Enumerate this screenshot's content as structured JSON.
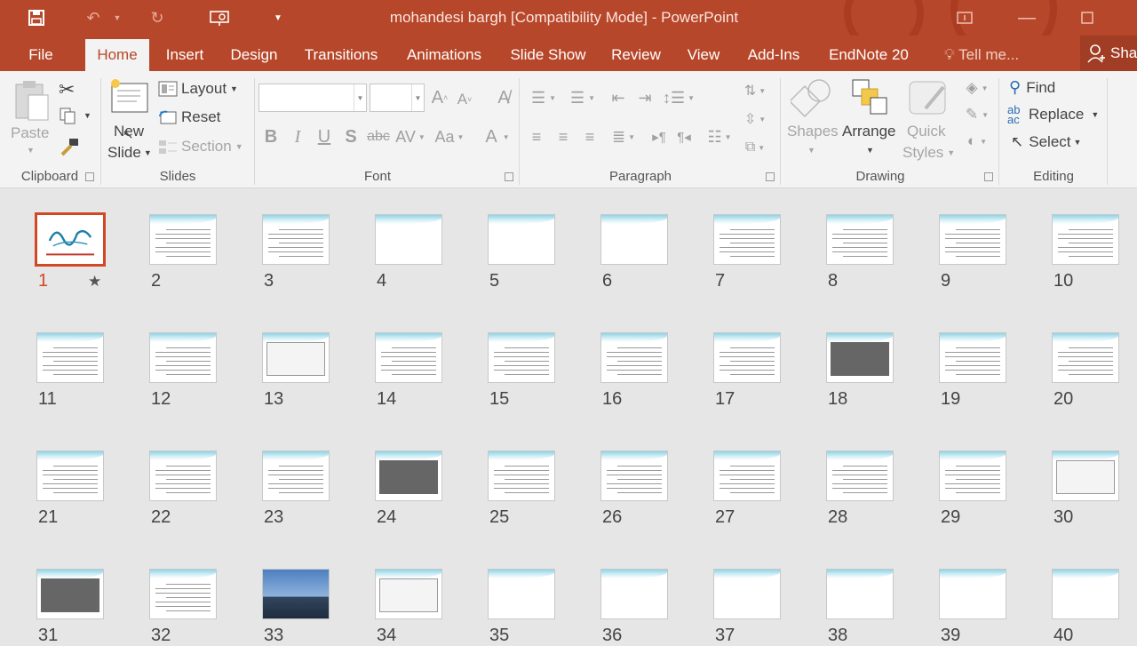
{
  "app": {
    "title": "mohandesi bargh [Compatibility Mode] - PowerPoint",
    "share_label": "Sha"
  },
  "tabs": [
    {
      "label": "File",
      "active": false
    },
    {
      "label": "Home",
      "active": true
    },
    {
      "label": "Insert",
      "active": false
    },
    {
      "label": "Design",
      "active": false
    },
    {
      "label": "Transitions",
      "active": false
    },
    {
      "label": "Animations",
      "active": false
    },
    {
      "label": "Slide Show",
      "active": false
    },
    {
      "label": "Review",
      "active": false
    },
    {
      "label": "View",
      "active": false
    },
    {
      "label": "Add-Ins",
      "active": false
    },
    {
      "label": "EndNote 20",
      "active": false
    },
    {
      "label": "Tell me...",
      "active": false
    }
  ],
  "ribbon": {
    "clipboard": {
      "group": "Clipboard",
      "paste": "Paste"
    },
    "slides": {
      "group": "Slides",
      "new_slide_1": "New",
      "new_slide_2": "Slide",
      "layout": "Layout",
      "reset": "Reset",
      "section": "Section"
    },
    "font": {
      "group": "Font",
      "font_name": "",
      "font_size": ""
    },
    "paragraph": {
      "group": "Paragraph"
    },
    "drawing": {
      "group": "Drawing",
      "shapes": "Shapes",
      "arrange": "Arrange",
      "quick_1": "Quick",
      "quick_2": "Styles"
    },
    "editing": {
      "group": "Editing",
      "find": "Find",
      "replace": "Replace",
      "select": "Select"
    }
  },
  "colors": {
    "accent": "#b7472a",
    "selection": "#d24726",
    "ribbon_bg": "#f3f3f3",
    "sorter_bg": "#e6e6e6"
  },
  "slides": [
    {
      "n": "1",
      "kind": "title",
      "selected": true,
      "star": "★"
    },
    {
      "n": "2",
      "kind": "text"
    },
    {
      "n": "3",
      "kind": "text"
    },
    {
      "n": "4",
      "kind": "blank"
    },
    {
      "n": "5",
      "kind": "blank"
    },
    {
      "n": "6",
      "kind": "blank"
    },
    {
      "n": "7",
      "kind": "text"
    },
    {
      "n": "8",
      "kind": "text"
    },
    {
      "n": "9",
      "kind": "text"
    },
    {
      "n": "10",
      "kind": "text"
    },
    {
      "n": "11",
      "kind": "text"
    },
    {
      "n": "12",
      "kind": "text"
    },
    {
      "n": "13",
      "kind": "diagram"
    },
    {
      "n": "14",
      "kind": "text"
    },
    {
      "n": "15",
      "kind": "text"
    },
    {
      "n": "16",
      "kind": "text"
    },
    {
      "n": "17",
      "kind": "text"
    },
    {
      "n": "18",
      "kind": "image"
    },
    {
      "n": "19",
      "kind": "text"
    },
    {
      "n": "20",
      "kind": "text"
    },
    {
      "n": "21",
      "kind": "text"
    },
    {
      "n": "22",
      "kind": "text"
    },
    {
      "n": "23",
      "kind": "text"
    },
    {
      "n": "24",
      "kind": "image"
    },
    {
      "n": "25",
      "kind": "text"
    },
    {
      "n": "26",
      "kind": "text"
    },
    {
      "n": "27",
      "kind": "text"
    },
    {
      "n": "28",
      "kind": "text"
    },
    {
      "n": "29",
      "kind": "text"
    },
    {
      "n": "30",
      "kind": "diagram"
    },
    {
      "n": "31",
      "kind": "image"
    },
    {
      "n": "32",
      "kind": "text"
    },
    {
      "n": "33",
      "kind": "photo"
    },
    {
      "n": "34",
      "kind": "diagram"
    },
    {
      "n": "35",
      "kind": "blank"
    },
    {
      "n": "36",
      "kind": "blank"
    },
    {
      "n": "37",
      "kind": "blank"
    },
    {
      "n": "38",
      "kind": "blank"
    },
    {
      "n": "39",
      "kind": "blank"
    },
    {
      "n": "40",
      "kind": "blank"
    }
  ]
}
